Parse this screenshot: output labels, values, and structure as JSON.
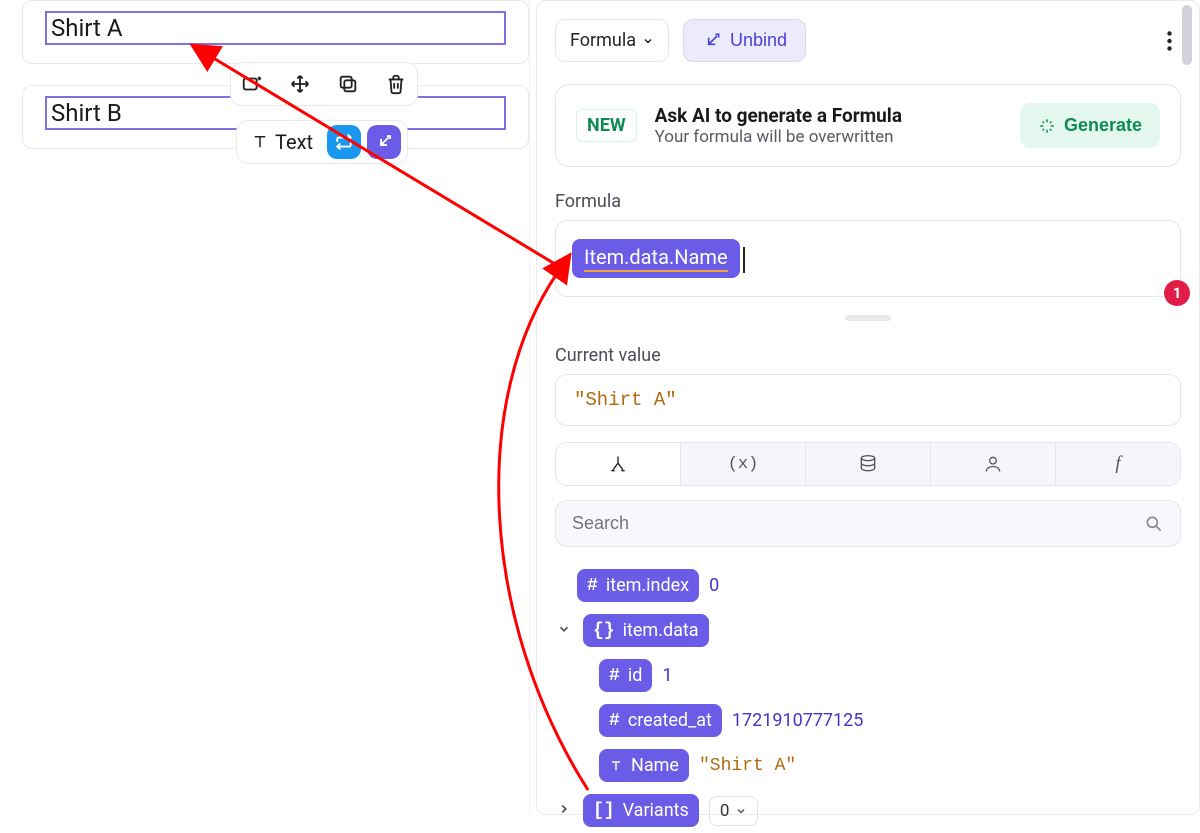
{
  "canvas": {
    "items": [
      "Shirt A",
      "Shirt B"
    ],
    "tag_label": "Text"
  },
  "panel": {
    "formula_select_label": "Formula",
    "unbind_label": "Unbind",
    "ai": {
      "new_badge": "NEW",
      "title": "Ask AI to generate a Formula",
      "subtitle": "Your formula will be overwritten",
      "generate_label": "Generate"
    },
    "formula_section_label": "Formula",
    "formula_chip_prefix": "Item.data.",
    "formula_chip_underlined": "Name",
    "error_count": "1",
    "current_value_label": "Current value",
    "current_value": "\"Shirt A\"",
    "search_placeholder": "Search",
    "tree": {
      "item_index_label": "item.index",
      "item_index_value": "0",
      "item_data_label": "item.data",
      "id_label": "id",
      "id_value": "1",
      "created_at_label": "created_at",
      "created_at_value": "1721910777125",
      "name_label": "Name",
      "name_value": "\"Shirt A\"",
      "variants_label": "Variants",
      "variants_count": "0"
    }
  }
}
